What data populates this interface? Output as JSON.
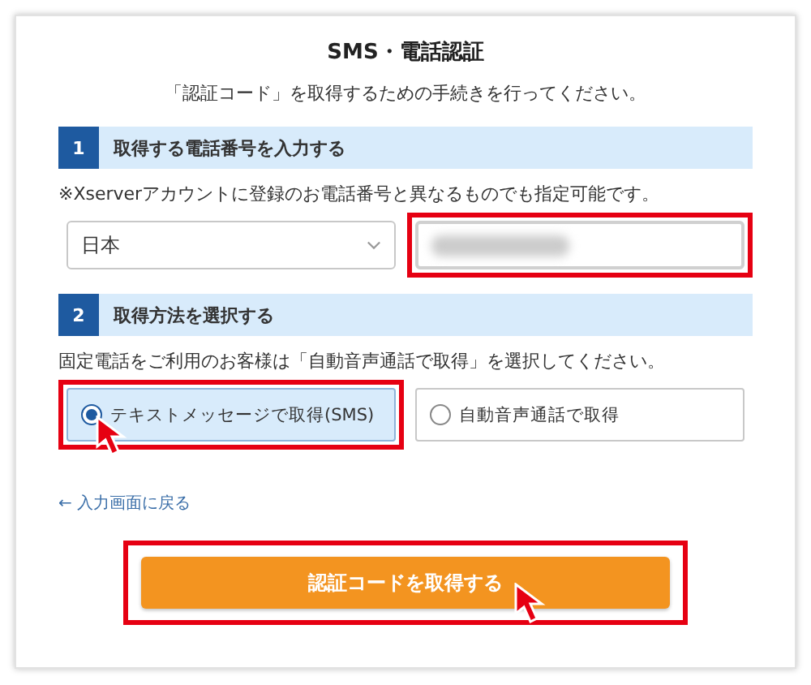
{
  "title": "SMS・電話認証",
  "subtitle": "「認証コード」を取得するための手続きを行ってください。",
  "steps": [
    {
      "number": "1",
      "label": "取得する電話番号を入力する"
    },
    {
      "number": "2",
      "label": "取得方法を選択する"
    }
  ],
  "phone_note": "※Xserverアカウントに登録のお電話番号と異なるものでも指定可能です。",
  "country_select": {
    "value": "日本"
  },
  "phone_field": {
    "highlighted": true
  },
  "method_note": "固定電話をご利用のお客様は「自動音声通話で取得」を選択してください。",
  "methods": [
    {
      "label": "テキストメッセージで取得(SMS)",
      "selected": true,
      "highlighted": true,
      "cursor": true
    },
    {
      "label": "自動音声通話で取得",
      "selected": false,
      "highlighted": false,
      "cursor": false
    }
  ],
  "back_link": "← 入力画面に戻る",
  "submit_button": {
    "label": "認証コードを取得する",
    "highlighted": true,
    "cursor": true
  }
}
